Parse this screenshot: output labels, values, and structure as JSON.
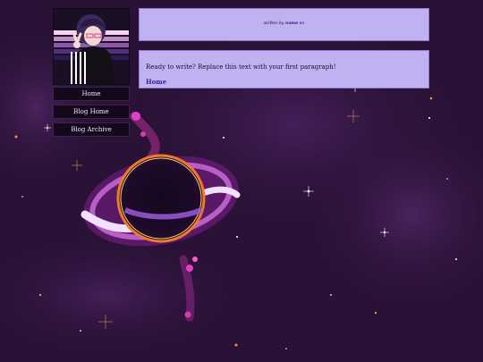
{
  "byline": {
    "prefix": "written by",
    "author": "name",
    "suffix": "on"
  },
  "post": {
    "paragraph": "Ready to write? Replace this text with your first paragraph!",
    "home_link": "Home"
  },
  "nav": [
    {
      "label": "Home"
    },
    {
      "label": "Blog Home"
    },
    {
      "label": "Blog Archive"
    }
  ],
  "colors": {
    "panel": "#c0b1f0",
    "nav_bg": "#14081c",
    "background": "#2a1236",
    "accent": "#3d1a9a"
  }
}
